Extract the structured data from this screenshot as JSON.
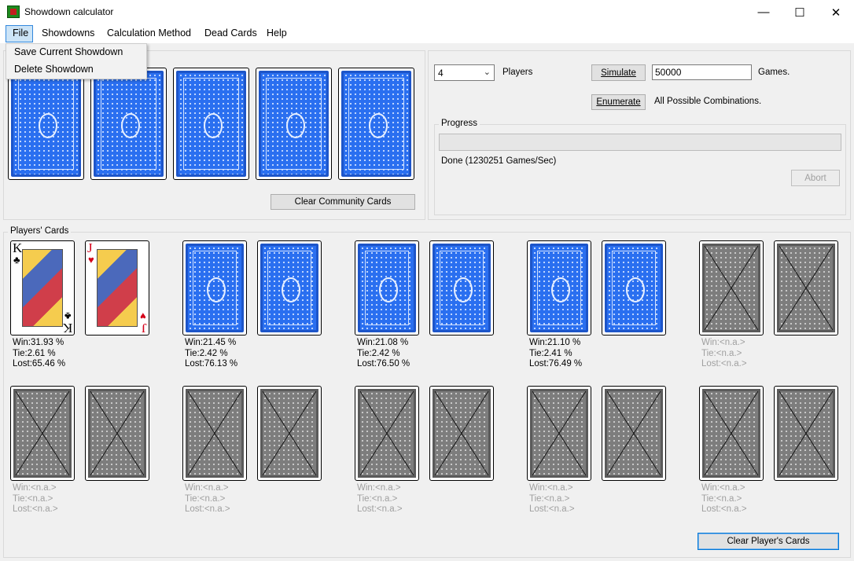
{
  "window": {
    "title": "Showdown calculator",
    "minimize": "—",
    "maximize": "☐",
    "close": "✕"
  },
  "menu": {
    "file": "File",
    "showdowns": "Showdowns",
    "calc_method": "Calculation Method",
    "dead_cards": "Dead Cards",
    "help": "Help",
    "file_items": [
      "Save Current Showdown",
      "Delete Showdown"
    ]
  },
  "community": {
    "clear_button": "Clear Community Cards",
    "cards": [
      "back",
      "back",
      "back",
      "back",
      "back"
    ]
  },
  "controls": {
    "players_value": "4",
    "players_label": "Players",
    "simulate_button": "Simulate",
    "games_value": "50000",
    "games_label": "Games.",
    "enumerate_button": "Enumerate",
    "enumerate_label": "All Possible Combinations.",
    "progress_label": "Progress",
    "progress_fraction": 0,
    "status_text": "Done (1230251 Games/Sec)",
    "abort_button": "Abort"
  },
  "players": {
    "label": "Players' Cards",
    "clear_button": "Clear Player's Cards",
    "seats": [
      {
        "cards": [
          {
            "rank": "K",
            "suit": "♣",
            "color": "#000000"
          },
          {
            "rank": "J",
            "suit": "♥",
            "color": "#d4001a"
          }
        ],
        "win": "Win:31.93 %",
        "tie": "Tie:2.61 %",
        "lost": "Lost:65.46 %",
        "active": true
      },
      {
        "cards": [
          "blue",
          "blue"
        ],
        "win": "Win:21.45 %",
        "tie": "Tie:2.42 %",
        "lost": "Lost:76.13 %",
        "active": true
      },
      {
        "cards": [
          "blue",
          "blue"
        ],
        "win": "Win:21.08 %",
        "tie": "Tie:2.42 %",
        "lost": "Lost:76.50 %",
        "active": true
      },
      {
        "cards": [
          "blue",
          "blue"
        ],
        "win": "Win:21.10 %",
        "tie": "Tie:2.41 %",
        "lost": "Lost:76.49 %",
        "active": true
      },
      {
        "cards": [
          "gray",
          "gray"
        ],
        "win": "Win:<n.a.>",
        "tie": "Tie:<n.a.>",
        "lost": "Lost:<n.a.>",
        "active": false
      },
      {
        "cards": [
          "gray",
          "gray"
        ],
        "win": "Win:<n.a.>",
        "tie": "Tie:<n.a.>",
        "lost": "Lost:<n.a.>",
        "active": false
      },
      {
        "cards": [
          "gray",
          "gray"
        ],
        "win": "Win:<n.a.>",
        "tie": "Tie:<n.a.>",
        "lost": "Lost:<n.a.>",
        "active": false
      },
      {
        "cards": [
          "gray",
          "gray"
        ],
        "win": "Win:<n.a.>",
        "tie": "Tie:<n.a.>",
        "lost": "Lost:<n.a.>",
        "active": false
      },
      {
        "cards": [
          "gray",
          "gray"
        ],
        "win": "Win:<n.a.>",
        "tie": "Tie:<n.a.>",
        "lost": "Lost:<n.a.>",
        "active": false
      },
      {
        "cards": [
          "gray",
          "gray"
        ],
        "win": "Win:<n.a.>",
        "tie": "Tie:<n.a.>",
        "lost": "Lost:<n.a.>",
        "active": false
      }
    ]
  },
  "colors": {
    "card_blue": "#2a6ff0",
    "card_gray": "#7d7d7d",
    "focus_blue": "#0078d7"
  }
}
